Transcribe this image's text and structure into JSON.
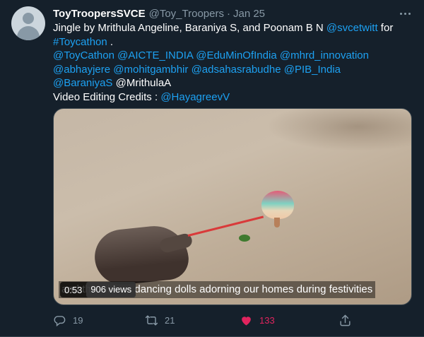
{
  "tweet": {
    "display_name": "ToyTroopersSVCE",
    "handle": "@Toy_Troopers",
    "separator": "·",
    "date": "Jan 25",
    "text_lines": [
      [
        {
          "t": "Jingle by Mrithula Angeline, Baraniya S, and Poonam B N ",
          "m": false
        },
        {
          "t": "@svcetwitt",
          "m": true
        },
        {
          "t": " for",
          "m": false
        }
      ],
      [
        {
          "t": "#Toycathon",
          "m": true
        },
        {
          "t": " .",
          "m": false
        }
      ],
      [
        {
          "t": "@ToyCathon",
          "m": true
        },
        {
          "t": " ",
          "m": false
        },
        {
          "t": "@AICTE_INDIA",
          "m": true
        },
        {
          "t": " ",
          "m": false
        },
        {
          "t": "@EduMinOfIndia",
          "m": true
        },
        {
          "t": " ",
          "m": false
        },
        {
          "t": "@mhrd_innovation",
          "m": true
        }
      ],
      [
        {
          "t": "@abhayjere",
          "m": true
        },
        {
          "t": " ",
          "m": false
        },
        {
          "t": "@mohitgambhir",
          "m": true
        },
        {
          "t": " ",
          "m": false
        },
        {
          "t": "@adsahasrabudhe",
          "m": true
        },
        {
          "t": " ",
          "m": false
        },
        {
          "t": "@PIB_India",
          "m": true
        }
      ],
      [
        {
          "t": "@BaraniyaS",
          "m": true
        },
        {
          "t": " @MrithulaA",
          "m": false
        }
      ],
      [
        {
          "t": "Video Editing Credits : ",
          "m": false
        },
        {
          "t": "@HayagreevV",
          "m": true
        }
      ]
    ]
  },
  "video": {
    "time": "0:53",
    "views": "906 views",
    "caption": "and the vibrant dancing dolls adorning our homes during festivities"
  },
  "actions": {
    "reply_count": "19",
    "retweet_count": "21",
    "like_count": "133"
  },
  "colors": {
    "background": "#15202b",
    "link": "#1da1f2",
    "muted": "#8899a6",
    "like": "#e0245e"
  },
  "icons": [
    "more-icon",
    "reply-icon",
    "retweet-icon",
    "like-icon",
    "share-icon",
    "avatar-placeholder-icon"
  ]
}
